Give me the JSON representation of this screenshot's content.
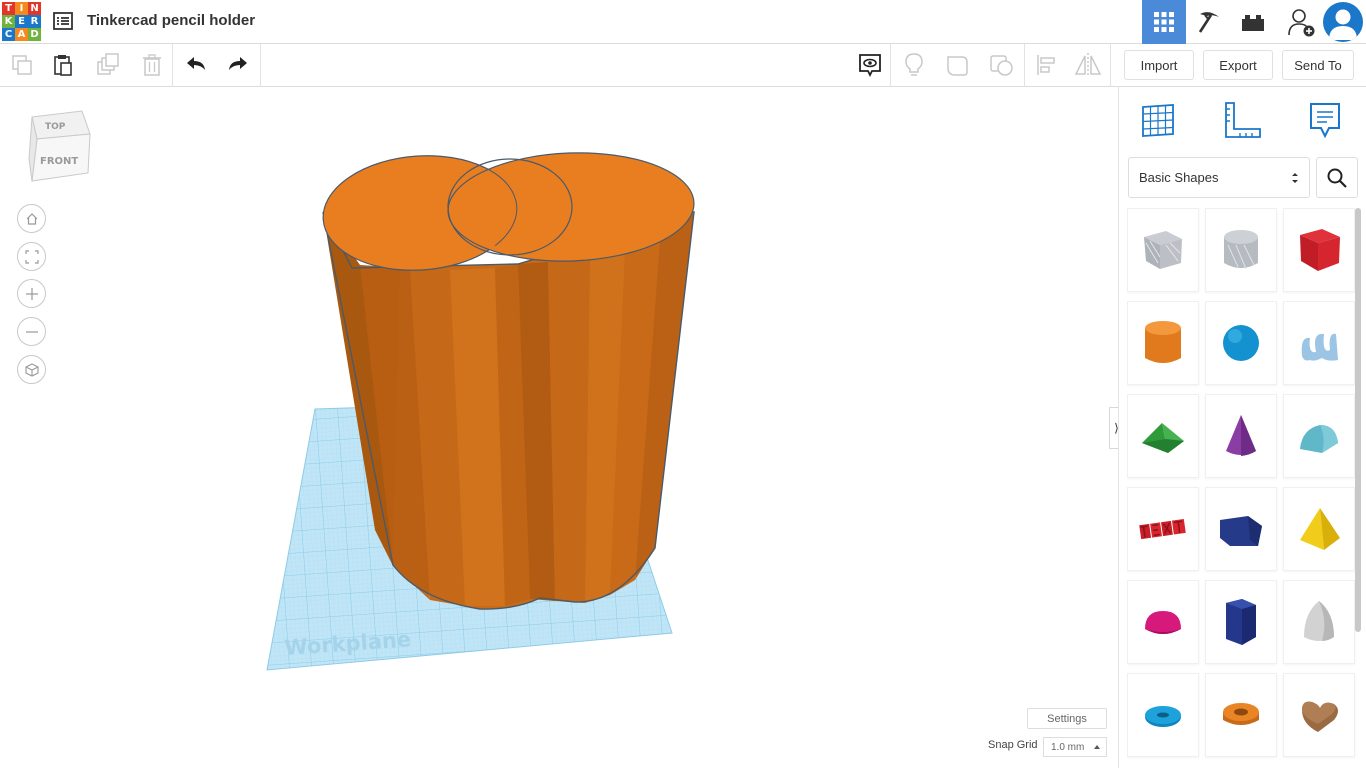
{
  "header": {
    "logo_letters": [
      "T",
      "I",
      "N",
      "K",
      "E",
      "R",
      "C",
      "A",
      "D"
    ],
    "logo_colors": [
      "#e2362b",
      "#f48a1e",
      "#e2362b",
      "#6fb23e",
      "#1b77c9",
      "#1b77c9",
      "#1b77c9",
      "#f48a1e",
      "#6fb23e"
    ],
    "title": "Tinkercad pencil holder",
    "views": [
      "3D Design",
      "Blocks",
      "Bricks"
    ],
    "accent_color": "#4a8ad8"
  },
  "toolbar": {
    "edit_icons": [
      "copy-icon",
      "paste-icon",
      "duplicate-icon",
      "delete-icon",
      "undo-icon",
      "redo-icon"
    ],
    "view_icons": [
      "notes-visibility-icon",
      "light-bulb-icon",
      "shape-union-icon",
      "shape-hole-icon",
      "align-icon",
      "mirror-icon"
    ],
    "import_label": "Import",
    "export_label": "Export",
    "send_to_label": "Send To"
  },
  "viewcube": {
    "top_label": "TOP",
    "front_label": "FRONT"
  },
  "nav_controls": [
    "home-icon",
    "fit-view-icon",
    "zoom-in-icon",
    "zoom-out-icon",
    "perspective-icon"
  ],
  "workplane": {
    "label": "Workplane"
  },
  "bottom_bar": {
    "settings_label": "Settings",
    "snap_grid_label": "Snap Grid",
    "snap_grid_value": "1.0 mm"
  },
  "panel": {
    "view_buttons": [
      "workplane-grid-icon",
      "ruler-icon",
      "notes-icon"
    ],
    "category": "Basic Shapes",
    "shapes": [
      "Box",
      "Cylinder",
      "Box",
      "Cylinder",
      "Sphere",
      "Scribble",
      "Roof",
      "Cone",
      "Round Roof",
      "Text",
      "Polygon",
      "Pyramid",
      "Half Sphere",
      "Polygon",
      "Paraboloid",
      "Torus",
      "Tube",
      "Heart"
    ]
  },
  "object_color": "#e97e21"
}
